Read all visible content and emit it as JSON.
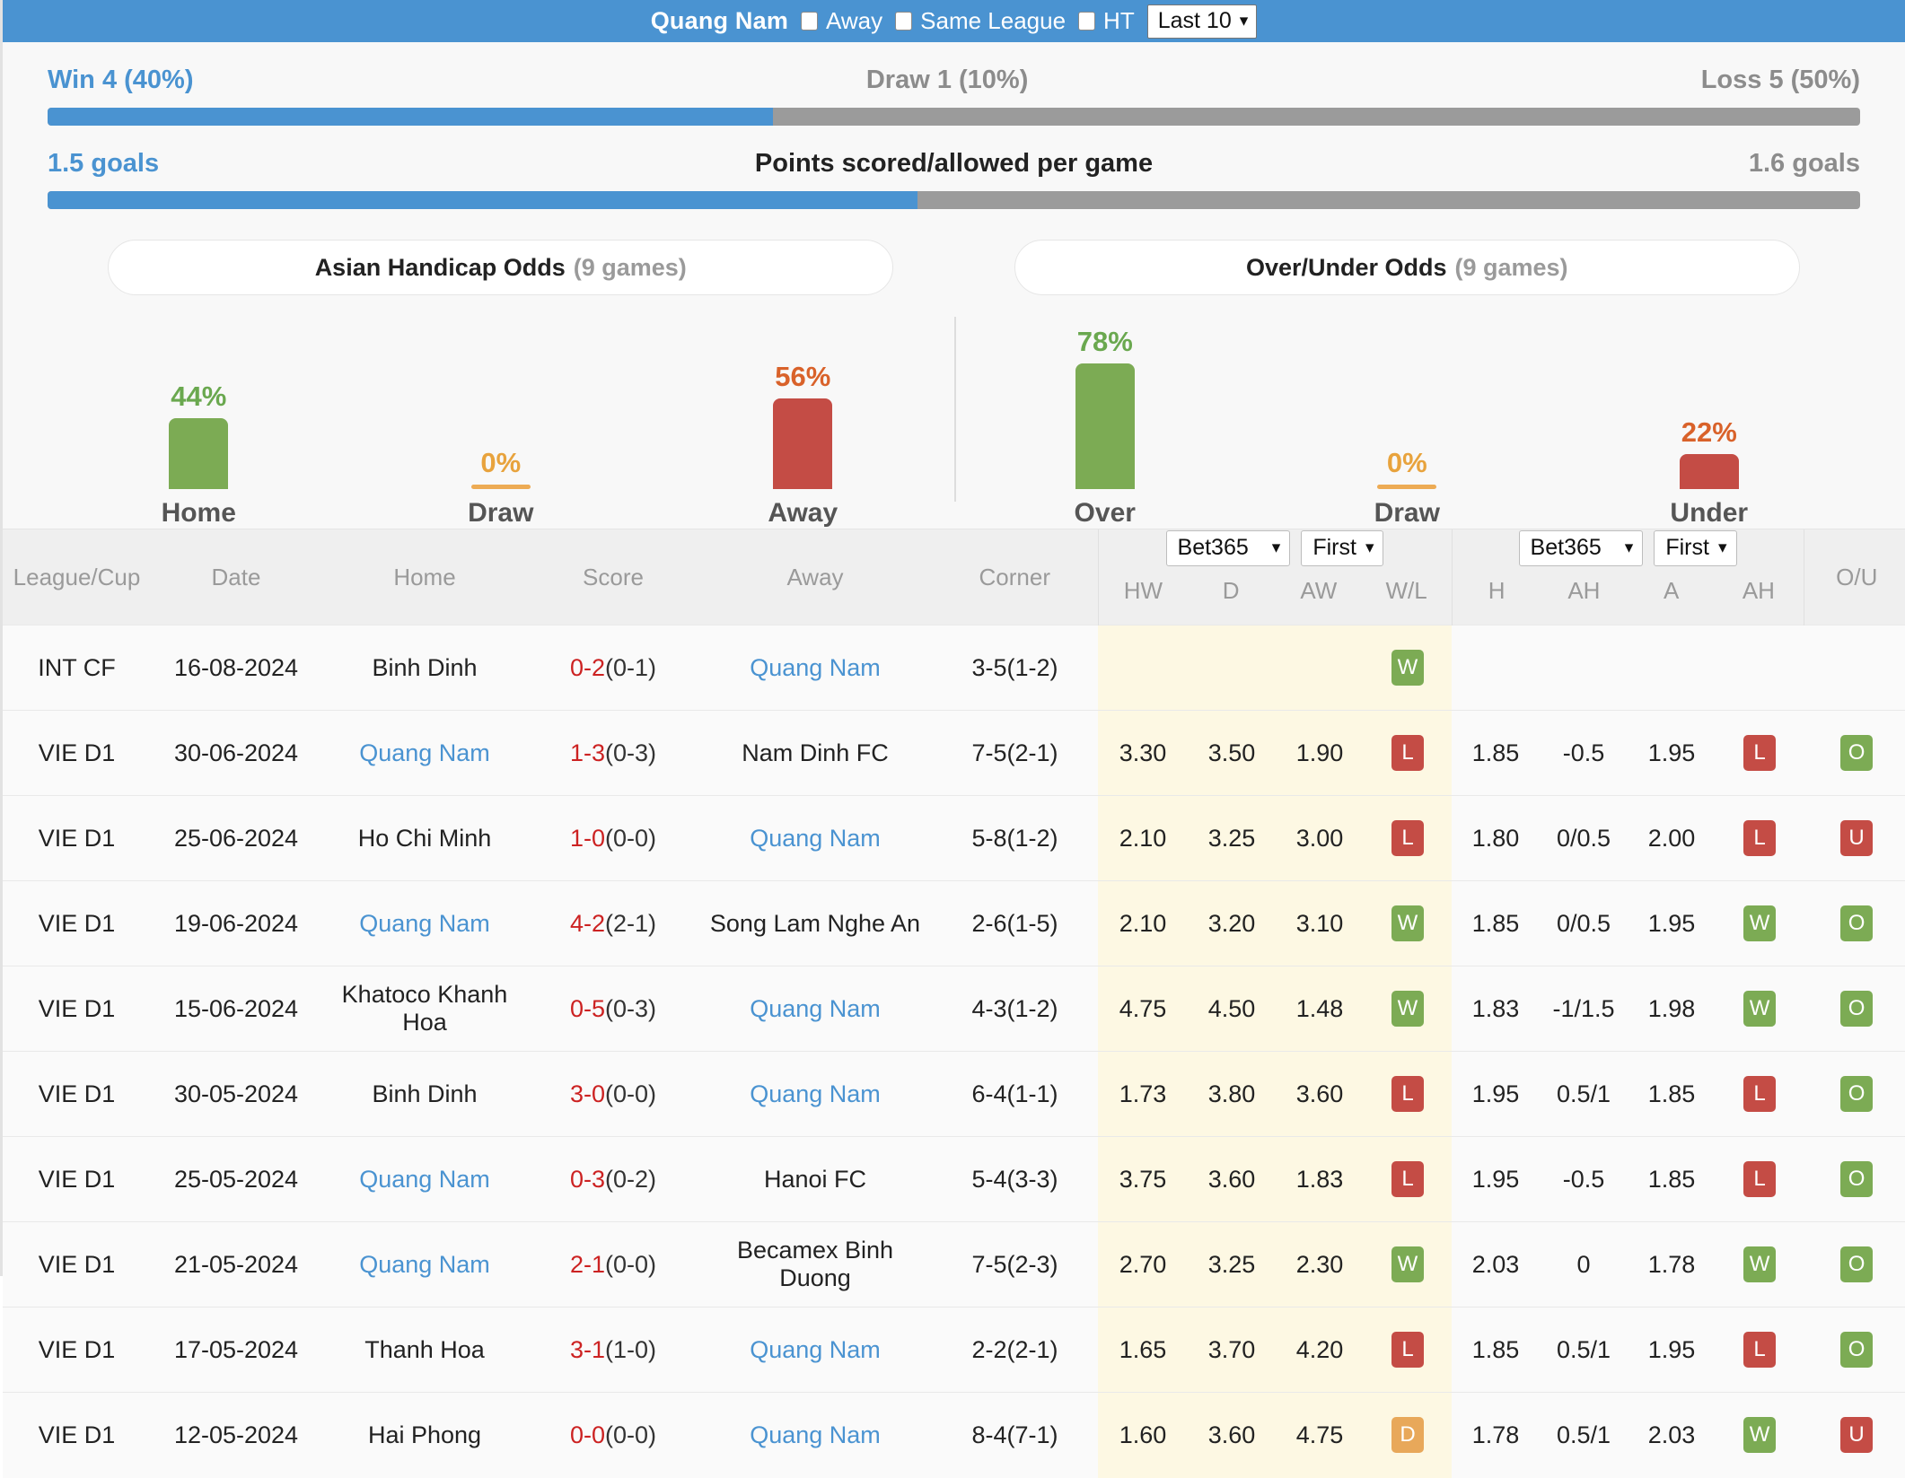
{
  "topbar": {
    "team": "Quang Nam",
    "checkboxes": [
      {
        "label": "Away",
        "checked": false
      },
      {
        "label": "Same League",
        "checked": false
      },
      {
        "label": "HT",
        "checked": false
      }
    ],
    "range_select": {
      "value": "Last 10",
      "caret": "chevron-down-icon"
    }
  },
  "summary": {
    "wdl": {
      "left": "Win 4 (40%)",
      "mid": "Draw 1 (10%)",
      "right": "Loss 5 (50%)",
      "fill_percent": 40
    },
    "goals": {
      "left": "1.5 goals",
      "mid": "Points scored/allowed per game",
      "right": "1.6 goals",
      "fill_percent": 48
    }
  },
  "tabs": [
    {
      "title": "Asian Handicap Odds",
      "games": "(9 games)"
    },
    {
      "title": "Over/Under Odds",
      "games": "(9 games)"
    }
  ],
  "chart_data": [
    {
      "type": "bar",
      "title": "Asian Handicap Odds",
      "categories": [
        "Home",
        "Draw",
        "Away"
      ],
      "values": [
        44,
        0,
        56
      ],
      "labels": [
        "44%",
        "0%",
        "56%"
      ],
      "colors": [
        "#7cab54",
        "#edab54",
        "#c44c45"
      ],
      "label_colors": [
        "#6aa84f",
        "#e8a33d",
        "#d9622a"
      ],
      "ylabel": "",
      "xlabel": "",
      "ylim": [
        0,
        100
      ]
    },
    {
      "type": "bar",
      "title": "Over/Under Odds",
      "categories": [
        "Over",
        "Draw",
        "Under"
      ],
      "values": [
        78,
        0,
        22
      ],
      "labels": [
        "78%",
        "0%",
        "22%"
      ],
      "colors": [
        "#7cab54",
        "#edab54",
        "#c44c45"
      ],
      "label_colors": [
        "#6aa84f",
        "#e8a33d",
        "#d9622a"
      ],
      "ylabel": "",
      "xlabel": "",
      "ylim": [
        0,
        100
      ]
    }
  ],
  "table": {
    "headers": {
      "league": "League/Cup",
      "date": "Date",
      "home": "Home",
      "score": "Score",
      "away": "Away",
      "corner": "Corner",
      "ou": "O/U"
    },
    "group1": {
      "bookmaker": "Bet365",
      "period": "First",
      "cols": [
        "HW",
        "D",
        "AW",
        "W/L"
      ]
    },
    "group2": {
      "bookmaker": "Bet365",
      "period": "First",
      "cols": [
        "H",
        "AH",
        "A",
        "AH"
      ]
    },
    "rows": [
      {
        "league": "INT CF",
        "date": "16-08-2024",
        "home": "Binh Dinh",
        "home_link": false,
        "score": "0-2",
        "ht": "(0-1)",
        "away": "Quang Nam",
        "away_link": true,
        "corner": "3-5(1-2)",
        "hw": "",
        "d": "",
        "aw": "",
        "wl": "W",
        "h": "",
        "ah": "",
        "a": "",
        "ah2": "",
        "ou": ""
      },
      {
        "league": "VIE D1",
        "date": "30-06-2024",
        "home": "Quang Nam",
        "home_link": true,
        "score": "1-3",
        "ht": "(0-3)",
        "away": "Nam Dinh FC",
        "away_link": false,
        "corner": "7-5(2-1)",
        "hw": "3.30",
        "d": "3.50",
        "aw": "1.90",
        "wl": "L",
        "h": "1.85",
        "ah": "-0.5",
        "a": "1.95",
        "ah2": "L",
        "ou": "O"
      },
      {
        "league": "VIE D1",
        "date": "25-06-2024",
        "home": "Ho Chi Minh",
        "home_link": false,
        "score": "1-0",
        "ht": "(0-0)",
        "away": "Quang Nam",
        "away_link": true,
        "corner": "5-8(1-2)",
        "hw": "2.10",
        "d": "3.25",
        "aw": "3.00",
        "wl": "L",
        "h": "1.80",
        "ah": "0/0.5",
        "a": "2.00",
        "ah2": "L",
        "ou": "U"
      },
      {
        "league": "VIE D1",
        "date": "19-06-2024",
        "home": "Quang Nam",
        "home_link": true,
        "score": "4-2",
        "ht": "(2-1)",
        "away": "Song Lam Nghe An",
        "away_link": false,
        "corner": "2-6(1-5)",
        "hw": "2.10",
        "d": "3.20",
        "aw": "3.10",
        "wl": "W",
        "h": "1.85",
        "ah": "0/0.5",
        "a": "1.95",
        "ah2": "W",
        "ou": "O"
      },
      {
        "league": "VIE D1",
        "date": "15-06-2024",
        "home": "Khatoco Khanh Hoa",
        "home_link": false,
        "score": "0-5",
        "ht": "(0-3)",
        "away": "Quang Nam",
        "away_link": true,
        "corner": "4-3(1-2)",
        "hw": "4.75",
        "d": "4.50",
        "aw": "1.48",
        "wl": "W",
        "h": "1.83",
        "ah": "-1/1.5",
        "a": "1.98",
        "ah2": "W",
        "ou": "O"
      },
      {
        "league": "VIE D1",
        "date": "30-05-2024",
        "home": "Binh Dinh",
        "home_link": false,
        "score": "3-0",
        "ht": "(0-0)",
        "away": "Quang Nam",
        "away_link": true,
        "corner": "6-4(1-1)",
        "hw": "1.73",
        "d": "3.80",
        "aw": "3.60",
        "wl": "L",
        "h": "1.95",
        "ah": "0.5/1",
        "a": "1.85",
        "ah2": "L",
        "ou": "O"
      },
      {
        "league": "VIE D1",
        "date": "25-05-2024",
        "home": "Quang Nam",
        "home_link": true,
        "score": "0-3",
        "ht": "(0-2)",
        "away": "Hanoi FC",
        "away_link": false,
        "corner": "5-4(3-3)",
        "hw": "3.75",
        "d": "3.60",
        "aw": "1.83",
        "wl": "L",
        "h": "1.95",
        "ah": "-0.5",
        "a": "1.85",
        "ah2": "L",
        "ou": "O"
      },
      {
        "league": "VIE D1",
        "date": "21-05-2024",
        "home": "Quang Nam",
        "home_link": true,
        "score": "2-1",
        "ht": "(0-0)",
        "away": "Becamex Binh Duong",
        "away_link": false,
        "corner": "7-5(2-3)",
        "hw": "2.70",
        "d": "3.25",
        "aw": "2.30",
        "wl": "W",
        "h": "2.03",
        "ah": "0",
        "a": "1.78",
        "ah2": "W",
        "ou": "O"
      },
      {
        "league": "VIE D1",
        "date": "17-05-2024",
        "home": "Thanh Hoa",
        "home_link": false,
        "score": "3-1",
        "ht": "(1-0)",
        "away": "Quang Nam",
        "away_link": true,
        "corner": "2-2(2-1)",
        "hw": "1.65",
        "d": "3.70",
        "aw": "4.20",
        "wl": "L",
        "h": "1.85",
        "ah": "0.5/1",
        "a": "1.95",
        "ah2": "L",
        "ou": "O"
      },
      {
        "league": "VIE D1",
        "date": "12-05-2024",
        "home": "Hai Phong",
        "home_link": false,
        "score": "0-0",
        "ht": "(0-0)",
        "away": "Quang Nam",
        "away_link": true,
        "corner": "8-4(7-1)",
        "hw": "1.60",
        "d": "3.60",
        "aw": "4.75",
        "wl": "D",
        "h": "1.78",
        "ah": "0.5/1",
        "a": "2.03",
        "ah2": "W",
        "ou": "U"
      }
    ]
  },
  "colors": {
    "accent": "#4a93d1",
    "win": "#7cab54",
    "loss": "#c44c45",
    "draw": "#e8a85a",
    "highlight": "#fdf8e3"
  }
}
